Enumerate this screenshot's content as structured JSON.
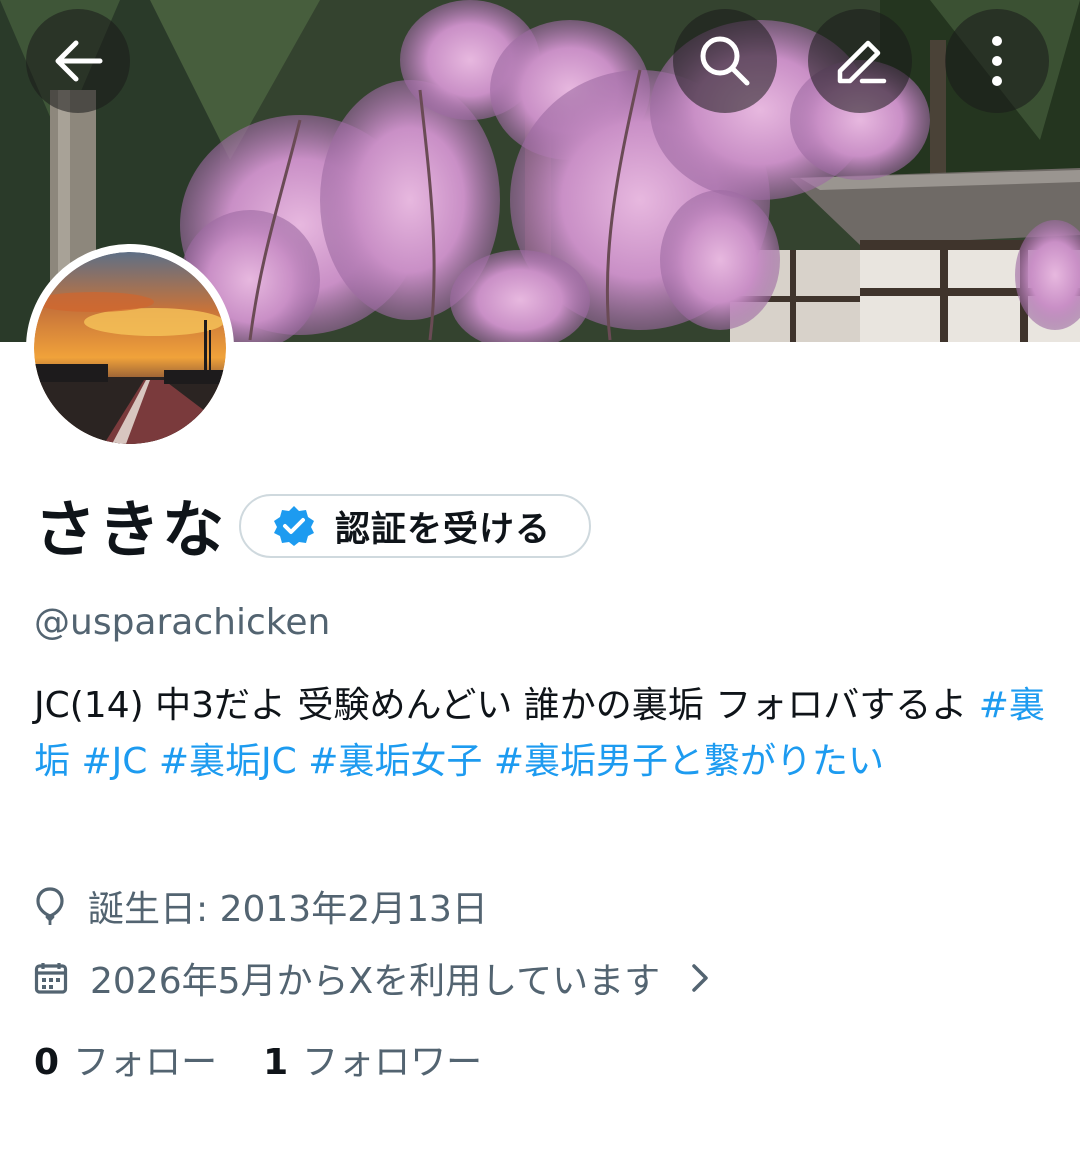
{
  "header": {
    "back_icon": "arrow-left-icon",
    "search_icon": "search-icon",
    "edit_icon": "pencil-icon",
    "more_icon": "more-vertical-icon"
  },
  "profile": {
    "display_name": "さきな",
    "verify_label": "認証を受ける",
    "handle": "@usparachicken",
    "bio_text": "JC(14) 中3だよ 受験めんどい 誰かの裏垢 フォロバするよ ",
    "bio_hashtags": [
      "#裏垢",
      "#JC",
      "#裏垢JC",
      "#裏垢女子",
      "#裏垢男子と繋がりたい"
    ],
    "birthday": "誕生日: 2013年2月13日",
    "joined": "2026年5月からXを利用しています"
  },
  "stats": {
    "following_count": "0",
    "following_label": "フォロー",
    "followers_count": "1",
    "followers_label": "フォロワー"
  },
  "colors": {
    "accent": "#1d9bf0",
    "secondary_text": "#536471",
    "primary_text": "#0f1419",
    "border": "#cfd9de"
  }
}
